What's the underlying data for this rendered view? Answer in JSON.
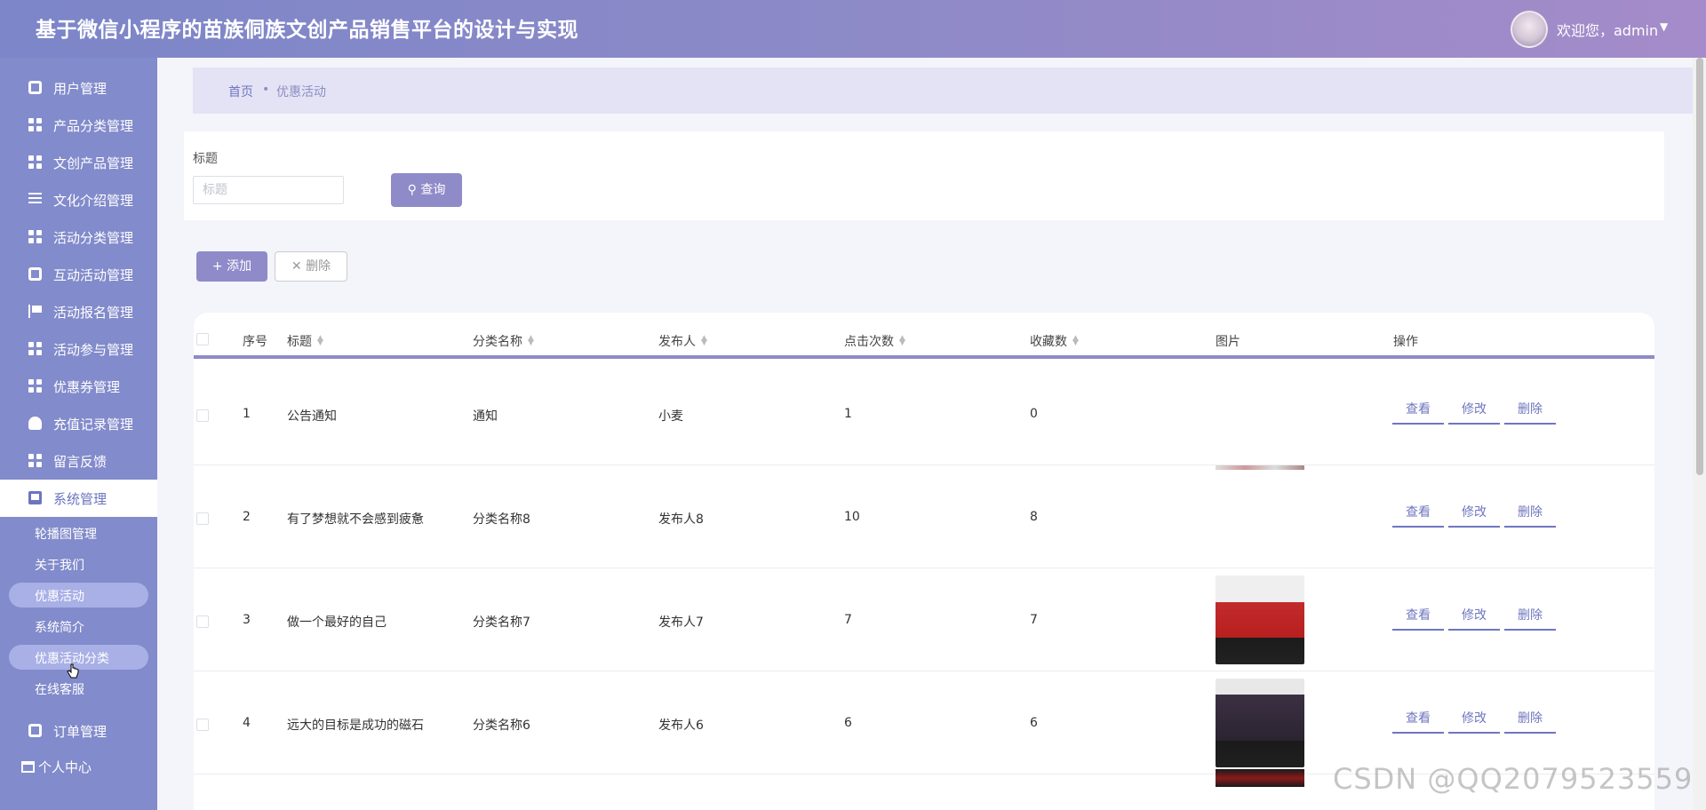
{
  "header": {
    "title": "基于微信小程序的苗族侗族文创产品销售平台的设计与实现",
    "welcome": "欢迎您，admin",
    "caret": "▼"
  },
  "sidebar": {
    "items": [
      {
        "label": "用户管理",
        "icon": "user-card-icon"
      },
      {
        "label": "产品分类管理",
        "icon": "grid-icon"
      },
      {
        "label": "文创产品管理",
        "icon": "grid-icon"
      },
      {
        "label": "文化介绍管理",
        "icon": "list-icon"
      },
      {
        "label": "活动分类管理",
        "icon": "grid-icon"
      },
      {
        "label": "互动活动管理",
        "icon": "ticket-icon"
      },
      {
        "label": "活动报名管理",
        "icon": "flag-icon"
      },
      {
        "label": "活动参与管理",
        "icon": "grid-icon"
      },
      {
        "label": "优惠券管理",
        "icon": "grid-icon"
      },
      {
        "label": "充值记录管理",
        "icon": "person-icon"
      },
      {
        "label": "留言反馈",
        "icon": "grid-icon"
      },
      {
        "label": "系统管理",
        "icon": "monitor-icon"
      }
    ],
    "sub_items": [
      "轮播图管理",
      "关于我们",
      "优惠活动",
      "系统简介",
      "优惠活动分类",
      "在线客服"
    ],
    "after_items": [
      {
        "label": "订单管理",
        "icon": "clipboard-icon"
      }
    ],
    "personal": "个人中心"
  },
  "breadcrumb": {
    "home": "首页",
    "separator": "•",
    "current": "优惠活动"
  },
  "search": {
    "label": "标题",
    "placeholder": "标题",
    "query_button": "查询"
  },
  "actions": {
    "add": "添加",
    "delete": "删除"
  },
  "table": {
    "columns": [
      "序号",
      "标题",
      "分类名称",
      "发布人",
      "点击次数",
      "收藏数",
      "图片",
      "操作"
    ],
    "rows": [
      {
        "no": "1",
        "title": "公告通知",
        "category": "通知",
        "publisher": "小麦",
        "clicks": "1",
        "favorites": "0"
      },
      {
        "no": "2",
        "title": "有了梦想就不会感到疲惫",
        "category": "分类名称8",
        "publisher": "发布人8",
        "clicks": "10",
        "favorites": "8"
      },
      {
        "no": "3",
        "title": "做一个最好的自己",
        "category": "分类名称7",
        "publisher": "发布人7",
        "clicks": "7",
        "favorites": "7"
      },
      {
        "no": "4",
        "title": "远大的目标是成功的磁石",
        "category": "分类名称6",
        "publisher": "发布人6",
        "clicks": "6",
        "favorites": "6"
      }
    ],
    "ops": {
      "view": "查看",
      "edit": "修改",
      "delete": "删除"
    }
  },
  "watermark": "CSDN @QQ2079523559",
  "colors": {
    "accent": "#8f8ac8",
    "sidebar": "#828bcb",
    "link": "#6f76bf"
  }
}
